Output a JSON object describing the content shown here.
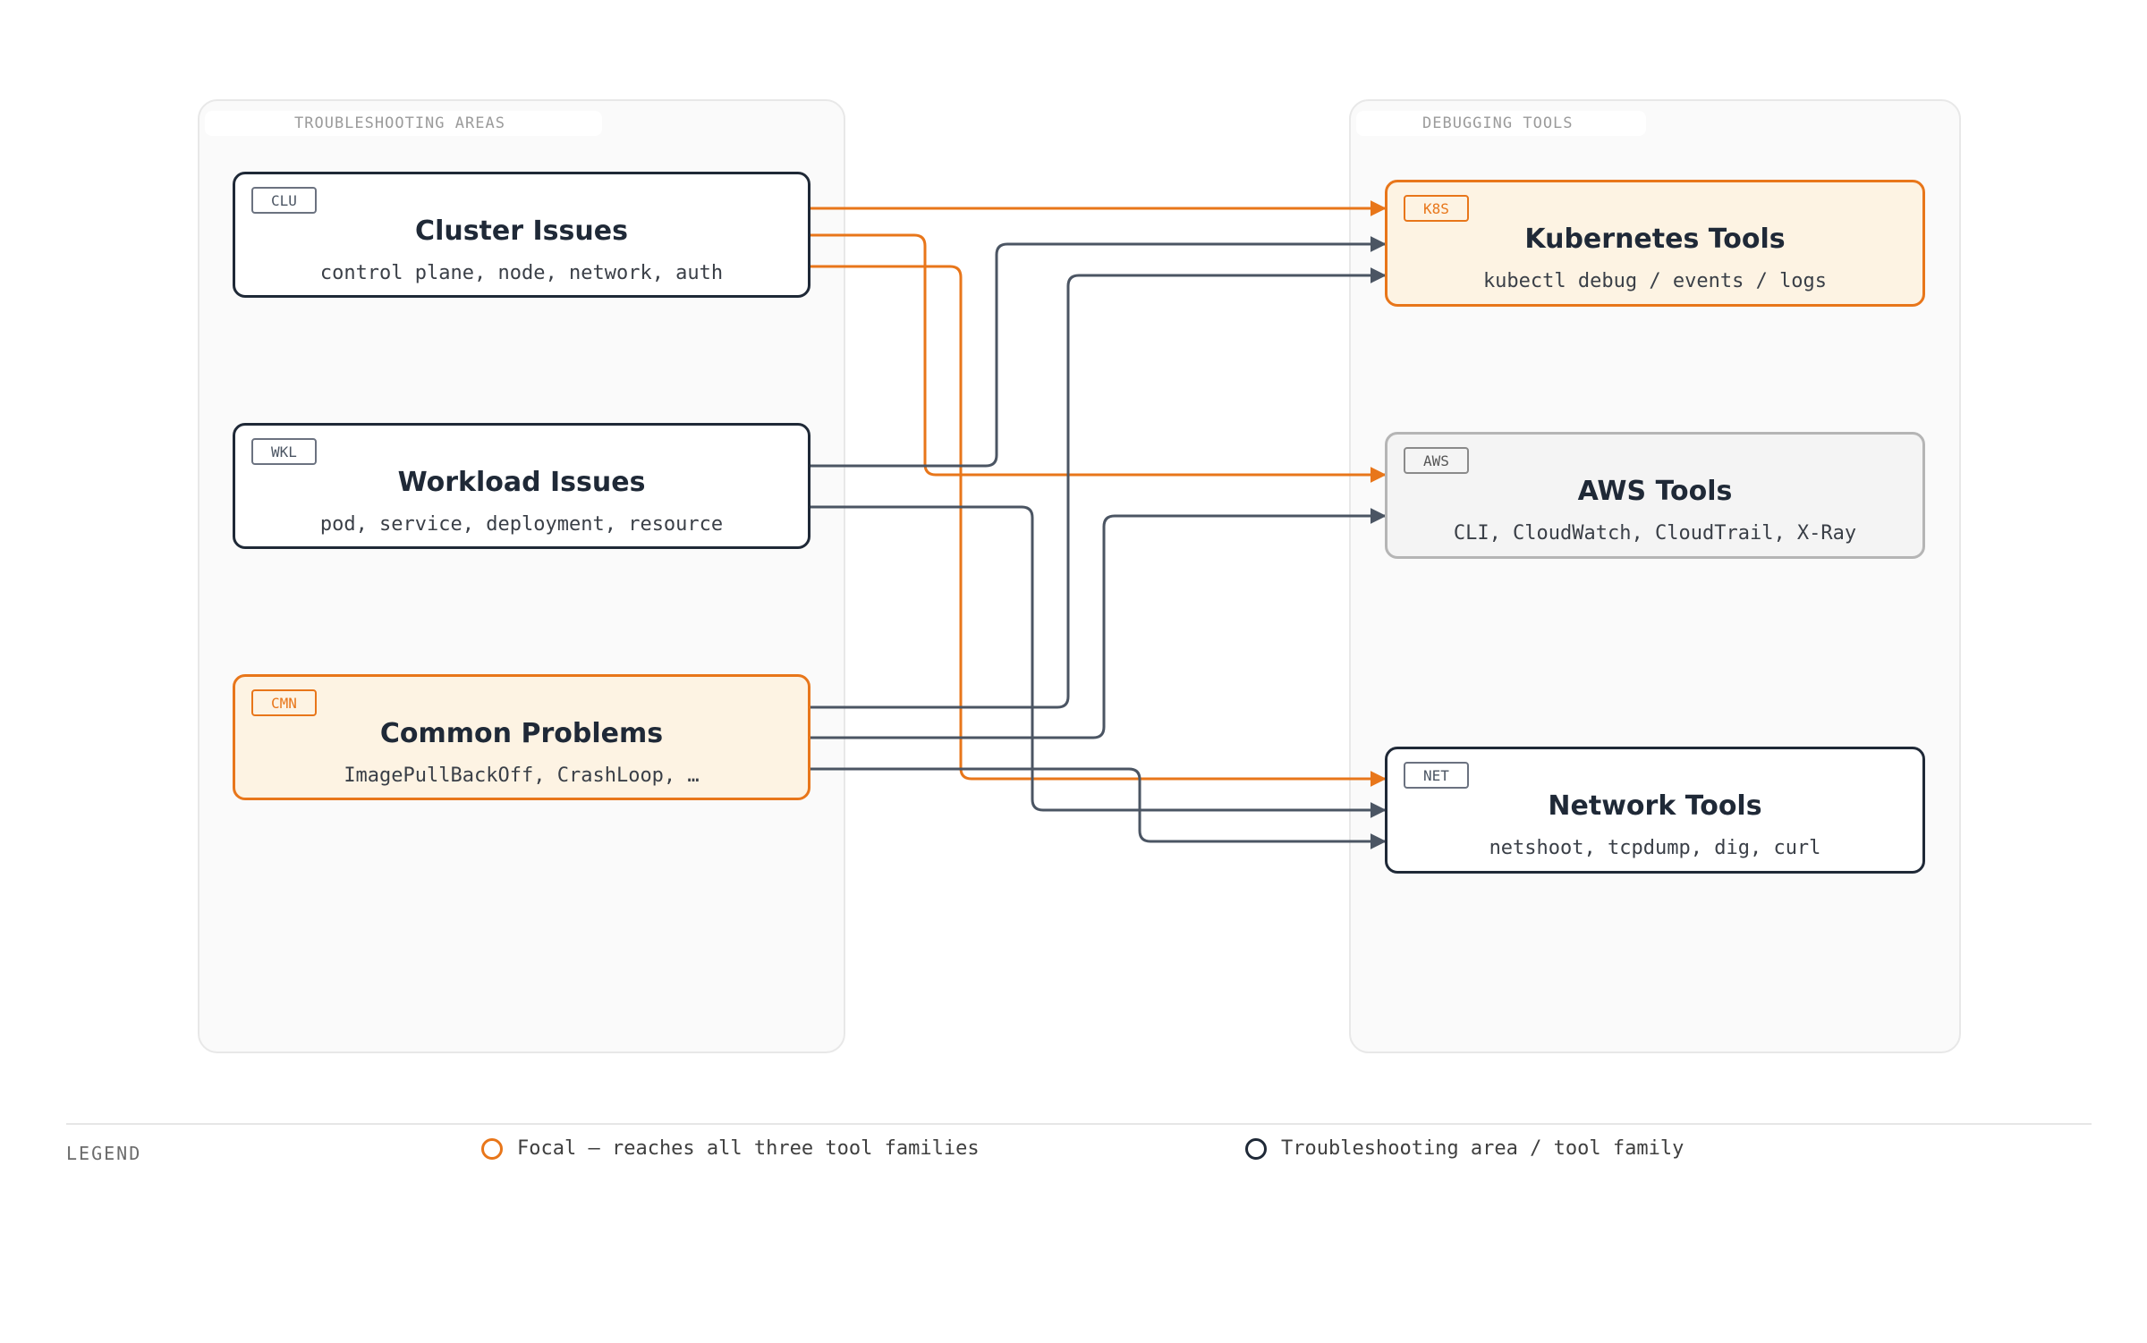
{
  "groups": {
    "left": {
      "title": "TROUBLESHOOTING AREAS"
    },
    "right": {
      "title": "DEBUGGING TOOLS"
    }
  },
  "nodes": {
    "cluster": {
      "badge": "CLU",
      "title": "Cluster Issues",
      "subtitle": "control plane, node, network, auth"
    },
    "workload": {
      "badge": "WKL",
      "title": "Workload Issues",
      "subtitle": "pod, service, deployment, resource"
    },
    "common": {
      "badge": "CMN",
      "title": "Common Problems",
      "subtitle": "ImagePullBackOff, CrashLoop, …"
    },
    "k8s": {
      "badge": "K8S",
      "title": "Kubernetes Tools",
      "subtitle": "kubectl debug / events / logs"
    },
    "aws": {
      "badge": "AWS",
      "title": "AWS Tools",
      "subtitle": "CLI, CloudWatch, CloudTrail, X-Ray"
    },
    "net": {
      "badge": "NET",
      "title": "Network Tools",
      "subtitle": "netshoot, tcpdump, dig, curl"
    }
  },
  "edges": [
    {
      "from": "cluster",
      "to": "k8s",
      "style": "focal"
    },
    {
      "from": "cluster",
      "to": "aws",
      "style": "focal"
    },
    {
      "from": "cluster",
      "to": "net",
      "style": "focal"
    },
    {
      "from": "workload",
      "to": "k8s",
      "style": "default"
    },
    {
      "from": "workload",
      "to": "net",
      "style": "default"
    },
    {
      "from": "common",
      "to": "k8s",
      "style": "default"
    },
    {
      "from": "common",
      "to": "aws",
      "style": "default"
    },
    {
      "from": "common",
      "to": "net",
      "style": "default"
    }
  ],
  "legend": {
    "label": "LEGEND",
    "items": [
      {
        "text": "Focal — reaches all three tool families",
        "color": "#e8761a"
      },
      {
        "text": "Troubleshooting area / tool family",
        "color": "#1f2937"
      }
    ]
  },
  "colors": {
    "focal": "#e8761a",
    "default": "#4b5563",
    "ink": "#1f2937"
  }
}
